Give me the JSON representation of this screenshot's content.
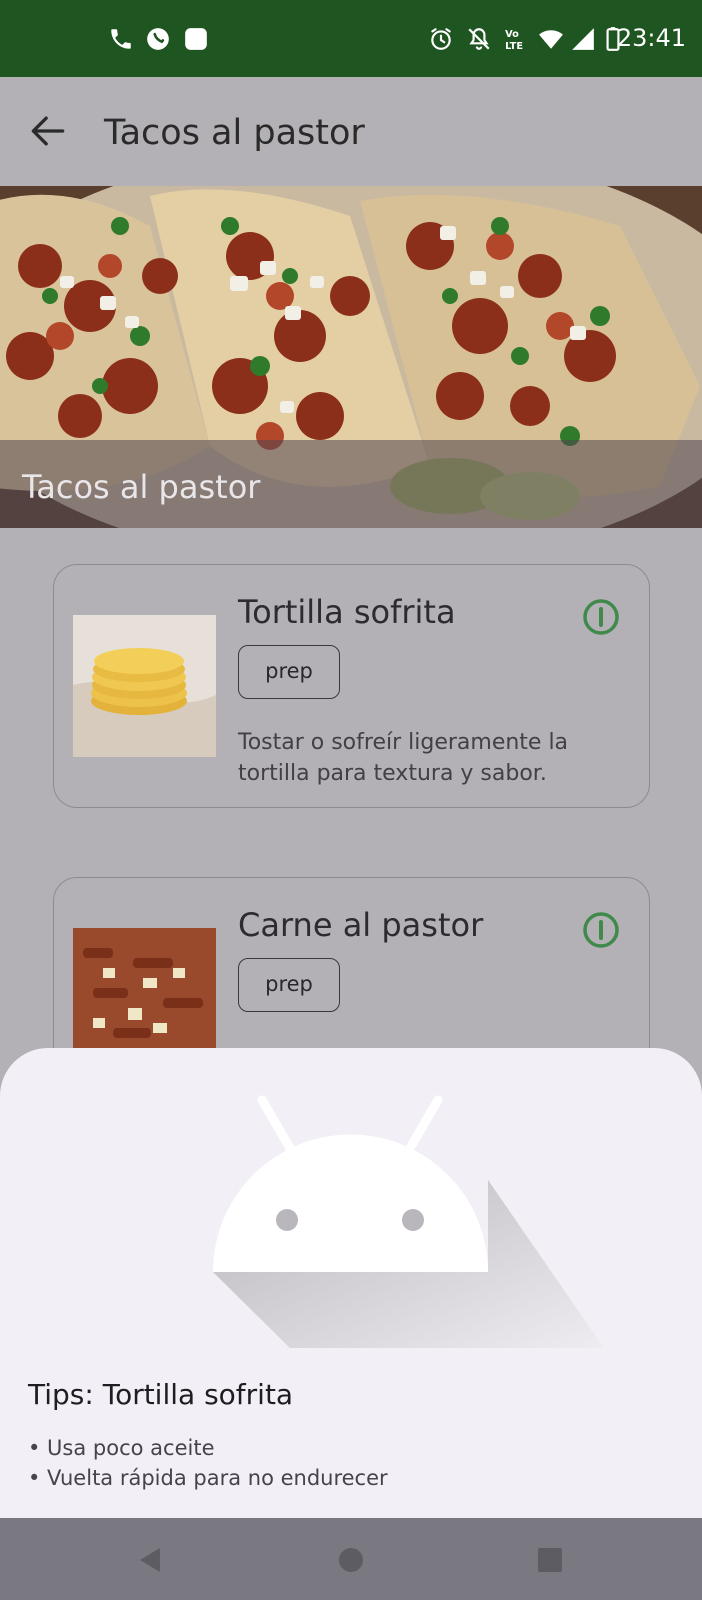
{
  "status_bar": {
    "time": "23:41",
    "left_icons": [
      "phone-icon",
      "whatsapp-icon",
      "app-square-icon"
    ],
    "right_icons": [
      "alarm-icon",
      "notifications-off-icon",
      "volte-icon",
      "wifi-icon",
      "signal-icon",
      "battery-icon"
    ],
    "background": "#1f5520"
  },
  "app_bar": {
    "title": "Tacos al pastor"
  },
  "hero": {
    "caption": "Tacos al pastor"
  },
  "cards": [
    {
      "title": "Tortilla sofrita",
      "chip": "prep",
      "description": "Tostar o sofreír ligeramente la tortilla para textura y sabor."
    },
    {
      "title": "Carne al pastor",
      "chip": "prep",
      "description": ""
    }
  ],
  "sheet": {
    "title": "Tips: Tortilla sofrita",
    "bullets": [
      "• Usa poco aceite",
      "• Vuelta rápida para no endurecer"
    ]
  },
  "colors": {
    "accent_green": "#3f8a4a",
    "scrim": "#b3b0b6",
    "sheet_bg": "#f3eff6"
  }
}
